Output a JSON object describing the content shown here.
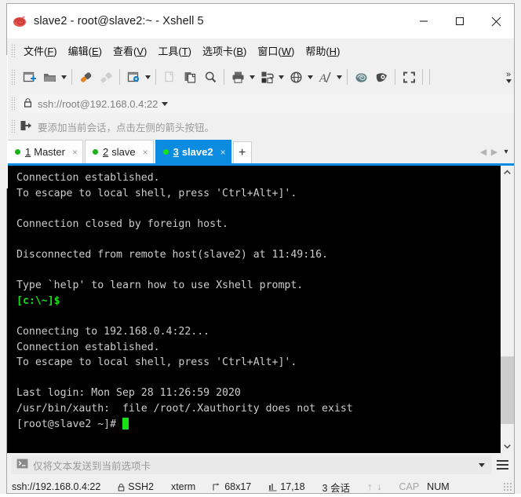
{
  "window": {
    "title": "slave2 - root@slave2:~ - Xshell 5",
    "app_icon": "xshell-shell-icon",
    "minimize": "—",
    "maximize": "☐",
    "close": "✕",
    "accent_color": "#0c8ce0"
  },
  "menu": {
    "items": [
      {
        "name": "file",
        "pre": "文件(",
        "key": "F",
        "post": ")"
      },
      {
        "name": "edit",
        "pre": "编辑(",
        "key": "E",
        "post": ")"
      },
      {
        "name": "view",
        "pre": "查看(",
        "key": "V",
        "post": ")"
      },
      {
        "name": "tools",
        "pre": "工具(",
        "key": "T",
        "post": ")"
      },
      {
        "name": "tabs",
        "pre": "选项卡(",
        "key": "B",
        "post": ")"
      },
      {
        "name": "window",
        "pre": "窗口(",
        "key": "W",
        "post": ")"
      },
      {
        "name": "help",
        "pre": "帮助(",
        "key": "H",
        "post": ")"
      }
    ]
  },
  "toolbar": {
    "buttons": [
      "new-session-icon",
      "open-folder-icon",
      "connect-icon",
      "disconnect-icon",
      "session-properties-icon",
      "copy-icon",
      "paste-icon",
      "find-icon",
      "print-icon",
      "file-transfer-icon",
      "globe-icon",
      "font-icon",
      "xshell-log-icon",
      "xftp-icon",
      "fullscreen-icon"
    ],
    "overflow": "»"
  },
  "address": {
    "lock_icon": "lock-icon",
    "value": "ssh://root@192.168.0.4:22",
    "dropdown": "▾"
  },
  "hint": {
    "icon": "add-session-arrow-icon",
    "text": "要添加当前会话，点击左侧的箭头按钮。"
  },
  "tabs": {
    "items": [
      {
        "index": "1",
        "label": "Master",
        "active": false,
        "close": "×"
      },
      {
        "index": "2",
        "label": "slave",
        "active": false,
        "close": "×"
      },
      {
        "index": "3",
        "label": "slave2",
        "active": true,
        "close": "×"
      }
    ],
    "new_tab": "+",
    "nav_prev": "◀",
    "nav_next": "▶",
    "nav_list": "▾"
  },
  "terminal": {
    "lines": [
      {
        "text": "Connection established.",
        "color": "default"
      },
      {
        "text": "To escape to local shell, press 'Ctrl+Alt+]'.",
        "color": "default"
      },
      {
        "text": "",
        "color": "default"
      },
      {
        "text": "Connection closed by foreign host.",
        "color": "default"
      },
      {
        "text": "",
        "color": "default"
      },
      {
        "text": "Disconnected from remote host(slave2) at 11:49:16.",
        "color": "default"
      },
      {
        "text": "",
        "color": "default"
      },
      {
        "text": "Type `help' to learn how to use Xshell prompt.",
        "color": "default"
      },
      {
        "text": "[c:\\~]$",
        "color": "green"
      },
      {
        "text": "",
        "color": "default"
      },
      {
        "text": "Connecting to 192.168.0.4:22...",
        "color": "default"
      },
      {
        "text": "Connection established.",
        "color": "default"
      },
      {
        "text": "To escape to local shell, press 'Ctrl+Alt+]'.",
        "color": "default"
      },
      {
        "text": "",
        "color": "default"
      },
      {
        "text": "Last login: Mon Sep 28 11:26:59 2020",
        "color": "default"
      },
      {
        "text": "/usr/bin/xauth:  file /root/.Xauthority does not exist",
        "color": "default"
      },
      {
        "text": "[root@slave2 ~]# ",
        "color": "default",
        "cursor": true
      }
    ],
    "background": "#000000",
    "foreground": "#cccccc",
    "green": "#18e018"
  },
  "sendbar": {
    "icon": "command-prompt-icon",
    "placeholder": "仅将文本发送到当前选项卡",
    "dropdown": "▾",
    "menu_icon": "hamburger-menu-icon"
  },
  "status": {
    "url": "ssh://192.168.0.4:22",
    "protocol": "SSH2",
    "terminal_type": "xterm",
    "size": "68x17",
    "cursor_pos": "17,18",
    "sessions": "3 会话",
    "cap": "CAP",
    "num": "NUM",
    "up_arrow": "↑",
    "down_arrow": "↓"
  }
}
